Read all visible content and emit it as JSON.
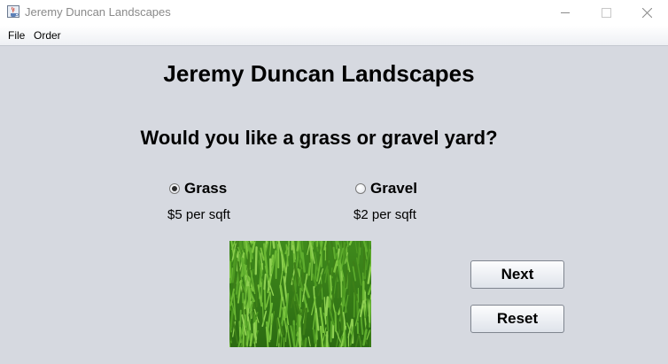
{
  "window": {
    "title": "Jeremy Duncan Landscapes",
    "controls": [
      "minimize-icon",
      "maximize-icon",
      "close-icon"
    ]
  },
  "menu": {
    "items": [
      {
        "label": "File"
      },
      {
        "label": "Order"
      }
    ]
  },
  "main": {
    "title": "Jeremy Duncan Landscapes",
    "question": "Would you like a grass or gravel yard?",
    "options": [
      {
        "label": "Grass",
        "price": "$5 per sqft",
        "selected": true
      },
      {
        "label": "Gravel",
        "price": "$2 per sqft",
        "selected": false
      }
    ],
    "buttons": {
      "next": "Next",
      "reset": "Reset"
    }
  },
  "colors": {
    "panel_background": "#d6d9e0",
    "title_text": "#8a8a8a"
  }
}
